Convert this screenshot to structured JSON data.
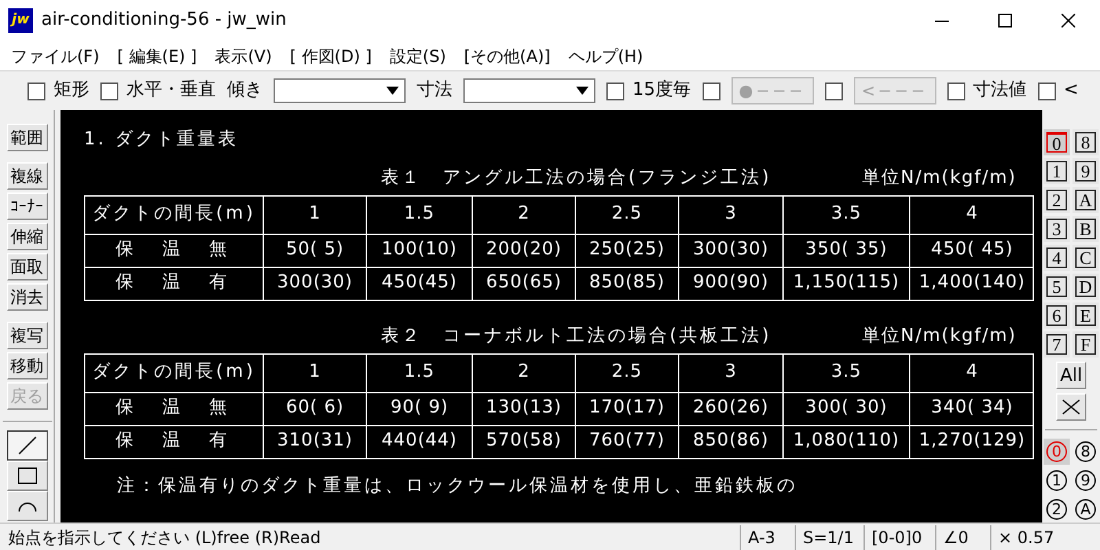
{
  "window": {
    "title": "air-conditioning-56 - jw_win",
    "icon_text": "jw"
  },
  "menu": [
    "ファイル(F)",
    "[ 編集(E) ]",
    "表示(V)",
    "[ 作図(D) ]",
    "設定(S)",
    "[その他(A)]",
    "ヘルプ(H)"
  ],
  "toolbar": [
    {
      "kind": "checkbox",
      "label": "矩形",
      "checked": false
    },
    {
      "kind": "checkbox",
      "label": "水平・垂直",
      "checked": false
    },
    {
      "kind": "label",
      "label": "傾き"
    },
    {
      "kind": "combo"
    },
    {
      "kind": "label",
      "label": "寸法"
    },
    {
      "kind": "combo"
    },
    {
      "kind": "checkbox",
      "label": "15度毎",
      "checked": false
    },
    {
      "kind": "checkbox",
      "checked": false
    },
    {
      "kind": "button",
      "label": "●−−−",
      "disabled": true
    },
    {
      "kind": "checkbox",
      "checked": false
    },
    {
      "kind": "button",
      "label": "<−−−",
      "disabled": true
    },
    {
      "kind": "checkbox",
      "label": "寸法値",
      "checked": false
    },
    {
      "kind": "checkbox",
      "label": "<",
      "checked": false
    }
  ],
  "left_tools": [
    {
      "label": "範囲",
      "disabled": false
    },
    {
      "label": "複線",
      "disabled": false
    },
    {
      "label": "ｺｰﾅｰ",
      "disabled": false
    },
    {
      "label": "伸縮",
      "disabled": false
    },
    {
      "label": "面取",
      "disabled": false
    },
    {
      "label": "消去",
      "disabled": false
    },
    {
      "label": "複写",
      "disabled": false
    },
    {
      "label": "移動",
      "disabled": false
    },
    {
      "label": "戻る",
      "disabled": true
    }
  ],
  "draw_tools": [
    {
      "kind": "line",
      "selected": true
    },
    {
      "kind": "rectangle",
      "selected": false
    },
    {
      "kind": "circle",
      "selected": false
    }
  ],
  "canvas": {
    "heading": "1. ダクト重量表",
    "tables": [
      {
        "caption": "表１　アングル工法の場合(フランジ工法)",
        "unit": "単位N/m(kgf/m)",
        "header": [
          "ダクトの間長(m)",
          "1",
          "1.5",
          "2",
          "2.5",
          "3",
          "3.5",
          "4"
        ],
        "rows": [
          [
            "保　温　無",
            "50( 5)",
            "100(10)",
            "200(20)",
            "250(25)",
            "300(30)",
            "350( 35)",
            "450( 45)"
          ],
          [
            "保　温　有",
            "300(30)",
            "450(45)",
            "650(65)",
            "850(85)",
            "900(90)",
            "1,150(115)",
            "1,400(140)"
          ]
        ]
      },
      {
        "caption": "表２　コーナボルト工法の場合(共板工法)",
        "unit": "単位N/m(kgf/m)",
        "header": [
          "ダクトの間長(m)",
          "1",
          "1.5",
          "2",
          "2.5",
          "3",
          "3.5",
          "4"
        ],
        "rows": [
          [
            "保　温　無",
            "60( 6)",
            "90( 9)",
            "130(13)",
            "170(17)",
            "260(26)",
            "300( 30)",
            "340( 34)"
          ],
          [
            "保　温　有",
            "310(31)",
            "440(44)",
            "570(58)",
            "760(77)",
            "850(86)",
            "1,080(110)",
            "1,270(129)"
          ]
        ]
      }
    ],
    "note": "注：保温有りのダクト重量は、ロックウール保温材を使用し、亜鉛鉄板の"
  },
  "layers": [
    {
      "label": "0",
      "selected": true
    },
    {
      "label": "8",
      "selected": false
    },
    {
      "label": "1",
      "selected": false
    },
    {
      "label": "9",
      "selected": false
    },
    {
      "label": "2",
      "selected": false
    },
    {
      "label": "A",
      "selected": false
    },
    {
      "label": "3",
      "selected": false
    },
    {
      "label": "B",
      "selected": false
    },
    {
      "label": "4",
      "selected": false
    },
    {
      "label": "C",
      "selected": false
    },
    {
      "label": "5",
      "selected": false
    },
    {
      "label": "D",
      "selected": false
    },
    {
      "label": "6",
      "selected": false
    },
    {
      "label": "E",
      "selected": false
    },
    {
      "label": "7",
      "selected": false
    },
    {
      "label": "F",
      "selected": false
    }
  ],
  "layer_all": "All",
  "layer_groups": [
    {
      "label": "0",
      "selected": true
    },
    {
      "label": "8",
      "selected": false
    },
    {
      "label": "1",
      "selected": false
    },
    {
      "label": "9",
      "selected": false
    },
    {
      "label": "2",
      "selected": false
    },
    {
      "label": "A",
      "selected": false
    }
  ],
  "status_bar": {
    "message": "始点を指示してください (L)free (R)Read",
    "fields": [
      "A-3",
      "S=1/1",
      "[0-0]0",
      "∠0",
      "× 0.57"
    ]
  }
}
